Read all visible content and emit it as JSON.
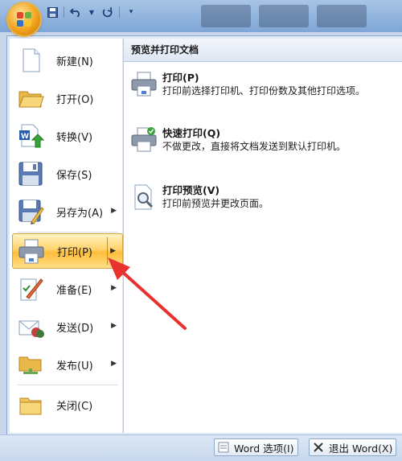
{
  "quick_access": {
    "icons": [
      "save-icon",
      "undo-icon",
      "dropdown-icon",
      "redo-icon",
      "customize-icon"
    ]
  },
  "menu": {
    "left_items": [
      {
        "label": "新建(N)",
        "icon": "new-document-icon",
        "has_submenu": false
      },
      {
        "label": "打开(O)",
        "icon": "open-folder-icon",
        "has_submenu": false
      },
      {
        "label": "转换(V)",
        "icon": "convert-icon",
        "has_submenu": false
      },
      {
        "label": "保存(S)",
        "icon": "save-disk-icon",
        "has_submenu": false
      },
      {
        "label": "另存为(A)",
        "icon": "save-as-icon",
        "has_submenu": true
      },
      {
        "label": "打印(P)",
        "icon": "printer-icon",
        "has_submenu": true,
        "active": true
      },
      {
        "label": "准备(E)",
        "icon": "prepare-icon",
        "has_submenu": true
      },
      {
        "label": "发送(D)",
        "icon": "send-icon",
        "has_submenu": true
      },
      {
        "label": "发布(U)",
        "icon": "publish-icon",
        "has_submenu": true
      },
      {
        "label": "关闭(C)",
        "icon": "close-folder-icon",
        "has_submenu": false
      }
    ],
    "submenu_title": "预览并打印文档",
    "submenu_items": [
      {
        "title": "打印(P)",
        "desc": "打印前选择打印机、打印份数及其他打印选项。",
        "icon": "print-dialog-icon"
      },
      {
        "title": "快速打印(Q)",
        "desc": "不做更改，直接将文档发送到默认打印机。",
        "icon": "quick-print-icon"
      },
      {
        "title": "打印预览(V)",
        "desc": "打印前预览并更改页面。",
        "icon": "print-preview-icon"
      }
    ]
  },
  "bottom": {
    "options_label": "Word 选项(I)",
    "exit_label": "退出 Word(X)"
  },
  "colors": {
    "active_highlight": "#ffd36b",
    "annotation_arrow": "#e8322e"
  }
}
